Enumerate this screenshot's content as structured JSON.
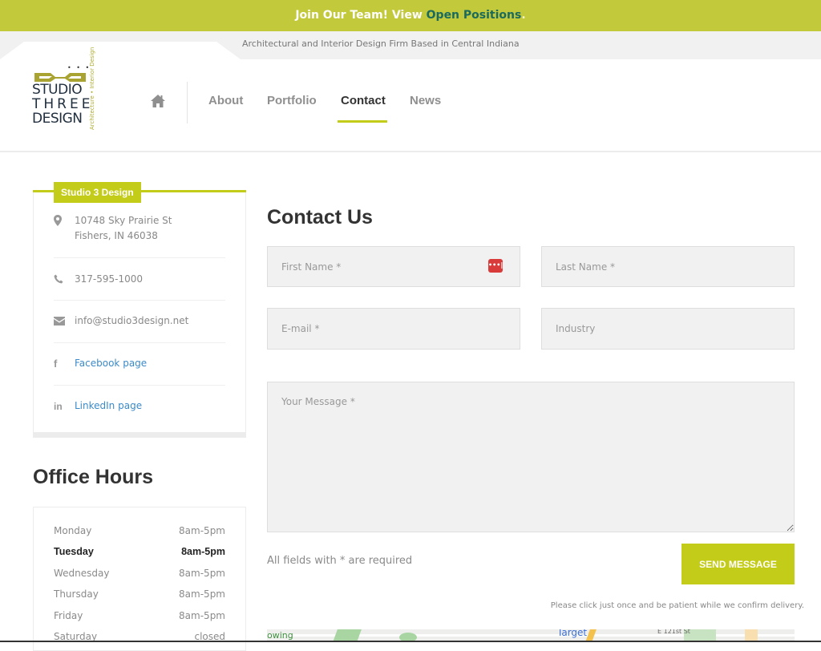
{
  "promo": {
    "text": "Join Our Team! View ",
    "link_text": "Open Positions",
    "suffix": "."
  },
  "tagline": "Architectural and Interior Design Firm Based in Central Indiana",
  "logo": {
    "line1": "STUDIO",
    "line2": "THREE",
    "line3": "DESIGN",
    "vertical_text": "Architecture • Interior Design",
    "dots": "• • •"
  },
  "nav": {
    "home_icon": "home-icon",
    "items": [
      {
        "label": "About",
        "active": false
      },
      {
        "label": "Portfolio",
        "active": false
      },
      {
        "label": "Contact",
        "active": true
      },
      {
        "label": "News",
        "active": false
      }
    ]
  },
  "sidebar": {
    "badge": "Studio 3 Design",
    "address_line1": "10748 Sky Prairie St",
    "address_line2": "Fishers, IN 46038",
    "phone": "317-595-1000",
    "email": "info@studio3design.net",
    "facebook": "Facebook page",
    "linkedin": "LinkedIn page",
    "icons": [
      "map-marker-icon",
      "phone-icon",
      "envelope-icon",
      "facebook-icon",
      "linkedin-icon"
    ]
  },
  "hours": {
    "title": "Office Hours",
    "rows": [
      {
        "day": "Monday",
        "hours": "8am-5pm",
        "today": false
      },
      {
        "day": "Tuesday",
        "hours": "8am-5pm",
        "today": true
      },
      {
        "day": "Wednesday",
        "hours": "8am-5pm",
        "today": false
      },
      {
        "day": "Thursday",
        "hours": "8am-5pm",
        "today": false
      },
      {
        "day": "Friday",
        "hours": "8am-5pm",
        "today": false
      },
      {
        "day": "Saturday",
        "hours": "closed",
        "today": false
      }
    ]
  },
  "form": {
    "title": "Contact Us",
    "first_name_placeholder": "First Name *",
    "last_name_placeholder": "Last Name *",
    "email_placeholder": "E-mail *",
    "industry_placeholder": "Industry",
    "message_placeholder": "Your Message *",
    "first_name_value": "",
    "last_name_value": "",
    "email_value": "",
    "industry_value": "",
    "message_value": "",
    "required_note": "All fields with * are required",
    "submit_label": "SEND MESSAGE",
    "patience_note": "Please click just once and be patient while we confirm delivery.",
    "password_manager_icon": "•••|"
  },
  "map": {
    "labels": [
      "owing",
      "Target",
      "E 121st St"
    ]
  },
  "colors": {
    "accent": "#c4cc1a",
    "promo_bg": "#c2c93a",
    "promo_link": "#1a6a5e",
    "link": "#3b8ac9",
    "heading": "#333333"
  }
}
